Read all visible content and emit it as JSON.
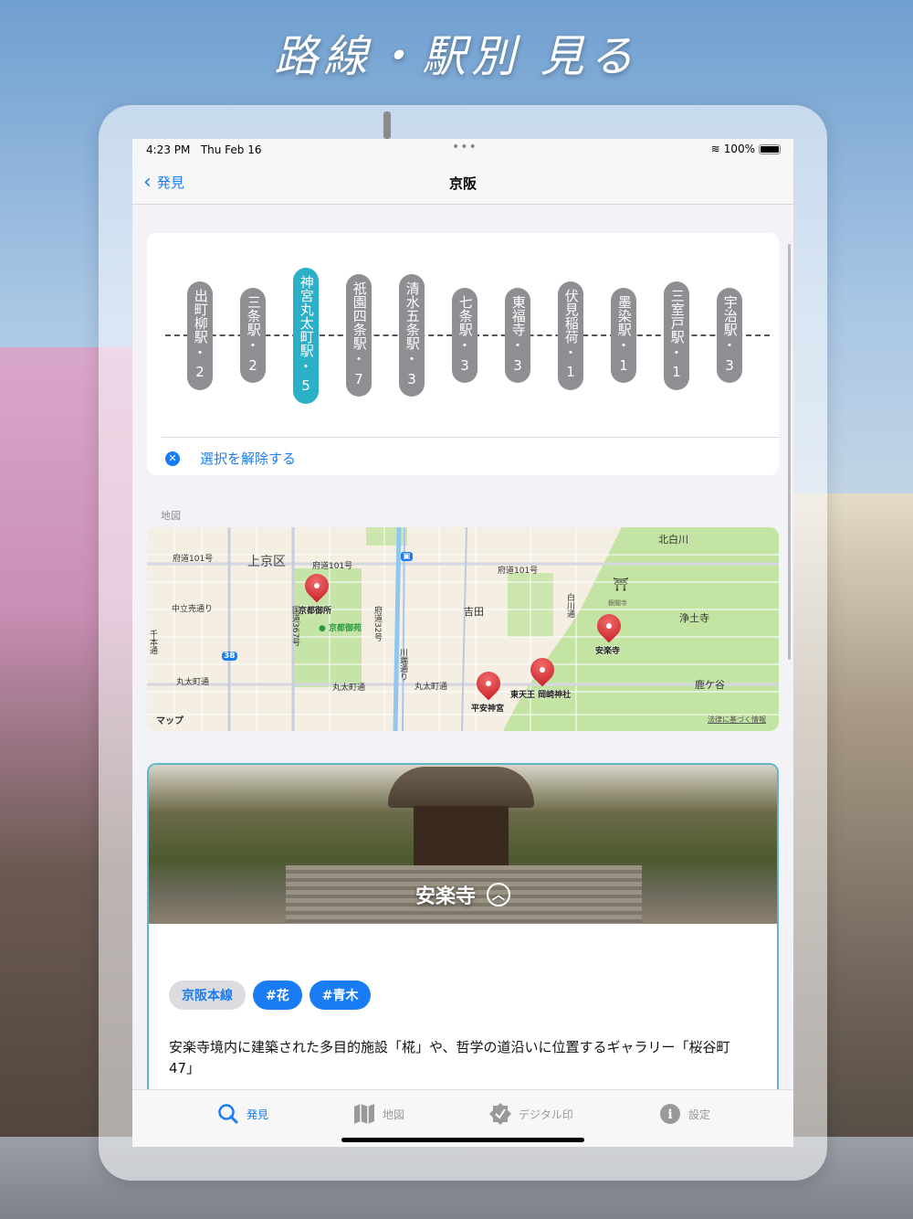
{
  "headline": "路線・駅別 見る",
  "status": {
    "time": "4:23 PM",
    "date": "Thu Feb 16",
    "battery": "100%"
  },
  "nav": {
    "back_label": "発見",
    "title": "京阪"
  },
  "stations": [
    {
      "name": "出町柳駅",
      "count": "2",
      "selected": false
    },
    {
      "name": "三条駅",
      "count": "2",
      "selected": false
    },
    {
      "name": "神宮丸太町駅",
      "count": "5",
      "selected": true
    },
    {
      "name": "祇園四条駅",
      "count": "7",
      "selected": false
    },
    {
      "name": "清水五条駅",
      "count": "3",
      "selected": false
    },
    {
      "name": "七条駅",
      "count": "3",
      "selected": false
    },
    {
      "name": "東福寺",
      "count": "3",
      "selected": false
    },
    {
      "name": "伏見稲荷",
      "count": "1",
      "selected": false
    },
    {
      "name": "墨染駅",
      "count": "1",
      "selected": false
    },
    {
      "name": "三室戸駅",
      "count": "1",
      "selected": false
    },
    {
      "name": "宇治駅",
      "count": "3",
      "selected": false
    }
  ],
  "deselect_label": "選択を解除する",
  "map_section_label": "地図",
  "map": {
    "labels": {
      "kamigyo": "上京区",
      "r101a": "府道101号",
      "r101b": "府道101号",
      "r101c": "府道101号",
      "nakadachiuri": "中立売通り",
      "senbon": "千本通",
      "r38": "38",
      "marutamachi_a": "丸太町通",
      "marutamachi_b": "丸太町通",
      "marutamachi_c": "丸太町通",
      "r367": "国道367号",
      "r32": "府道32号",
      "kawabata": "川端通り",
      "yoshida": "吉田",
      "shirakawa": "白川通",
      "kitashirakawa": "北白川",
      "ginkakuji": "銀閣寺",
      "jodoji": "浄土寺",
      "shishigatani": "鹿ケ谷",
      "gyoen": "京都御苑",
      "legal": "法律に基づく情報",
      "apple_maps": "マップ"
    },
    "pins": {
      "gosho": "京都御所",
      "anrakuji": "安楽寺",
      "okazaki": "東天王 岡崎神社",
      "heian": "平安神宮"
    }
  },
  "spot": {
    "name": "安楽寺",
    "tags": [
      "京阪本線",
      "#花",
      "#青木"
    ],
    "description": "安楽寺境内に建築された多目的施設「椛」や、哲学の道沿いに位置するギャラリー「桜谷町47」"
  },
  "tabs": [
    {
      "label": "発見",
      "icon": "search-icon"
    },
    {
      "label": "地図",
      "icon": "map-icon"
    },
    {
      "label": "デジタル印",
      "icon": "seal-check-icon"
    },
    {
      "label": "設定",
      "icon": "info-icon"
    }
  ],
  "colors": {
    "accent": "#1a7cf5",
    "selected_station": "#2bb0c8",
    "station": "#8e8e93"
  }
}
